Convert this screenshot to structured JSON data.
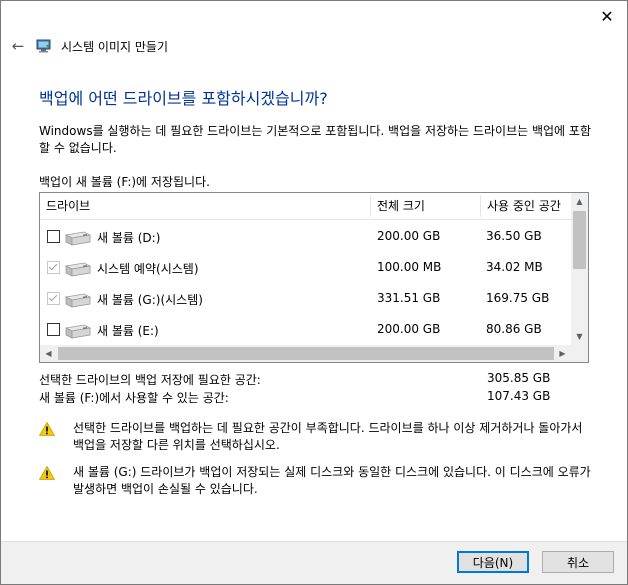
{
  "window": {
    "close_glyph": "✕",
    "back_glyph": "←",
    "title": "시스템 이미지 만들기"
  },
  "main": {
    "heading": "백업에 어떤 드라이브를 포함하시겠습니까?",
    "description": "Windows를 실행하는 데 필요한 드라이브는 기본적으로 포함됩니다. 백업을 저장하는 드라이브는 백업에 포함할 수 없습니다.",
    "saved_to": "백업이 새 볼륨 (F:)에 저장됩니다."
  },
  "table": {
    "columns": [
      "드라이브",
      "전체 크기",
      "사용 중인 공간"
    ],
    "rows": [
      {
        "name": "새 볼륨 (D:)",
        "total": "200.00 GB",
        "used": "36.50 GB",
        "checked": false,
        "locked": false
      },
      {
        "name": "시스템 예약(시스템)",
        "total": "100.00 MB",
        "used": "34.02 MB",
        "checked": true,
        "locked": true
      },
      {
        "name": "새 볼륨 (G:)(시스템)",
        "total": "331.51 GB",
        "used": "169.75 GB",
        "checked": true,
        "locked": true
      },
      {
        "name": "새 볼륨 (E:)",
        "total": "200.00 GB",
        "used": "80.86 GB",
        "checked": false,
        "locked": false
      }
    ]
  },
  "space": {
    "required_label": "선택한 드라이브의 백업 저장에 필요한 공간:",
    "required_value": "305.85 GB",
    "available_label": "새 볼륨 (F:)에서 사용할 수 있는 공간:",
    "available_value": "107.43 GB"
  },
  "warnings": [
    "선택한 드라이브를 백업하는 데 필요한 공간이 부족합니다. 드라이브를 하나 이상 제거하거나 돌아가서 백업을 저장할 다른 위치를 선택하십시오.",
    "새 볼륨 (G:) 드라이브가 백업이 저장되는 실제 디스크와 동일한 디스크에 있습니다. 이 디스크에 오류가 발생하면 백업이 손실될 수 있습니다."
  ],
  "buttons": {
    "next": "다음(N)",
    "cancel": "취소"
  },
  "colors": {
    "heading": "#003399",
    "default_button_border": "#0078d7",
    "warning_fill": "#f2c811"
  }
}
